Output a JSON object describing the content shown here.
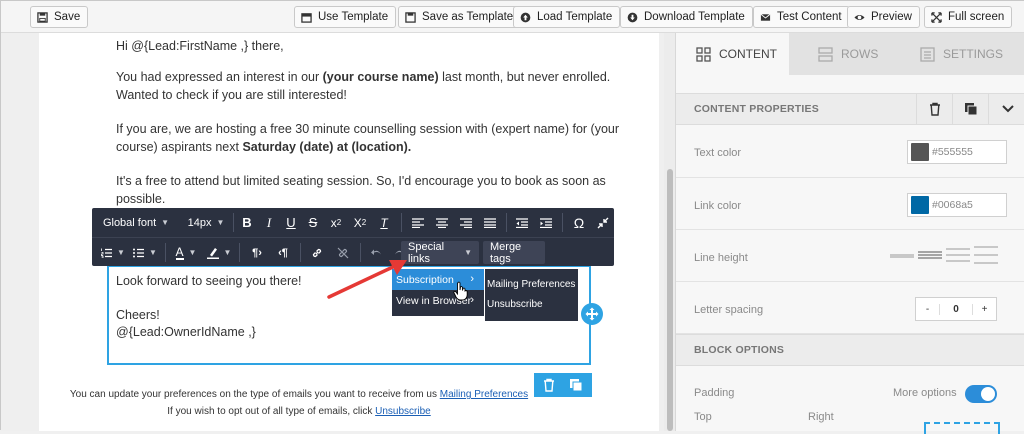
{
  "toolbar": {
    "save": "Save",
    "use_template": "Use Template",
    "save_as_template": "Save as Template",
    "load_template": "Load Template",
    "download_template": "Download Template",
    "test_content": "Test Content",
    "preview": "Preview",
    "full_screen": "Full screen"
  },
  "email": {
    "greeting": "Hi @{Lead:FirstName ,} there,",
    "p1a": "You had expressed an interest in our ",
    "p1b": "(your course name)",
    "p1c": " last month, but never enrolled.",
    "p1d": "Wanted to check if you are still interested!",
    "p2a": "If you are, we are hosting a free 30 minute counselling session with (expert name) for (your",
    "p2b": "course) aspirants next ",
    "p2c": "Saturday (date) at (location).",
    "p3a": "It's a free to attend but limited seating session. So, I'd encourage you to book as soon as",
    "p3b": "possible.",
    "p4": "Look forward to seeing you there!",
    "p5": "Cheers!",
    "p6": "@{Lead:OwnerIdName ,}",
    "footer1a": "You can update your preferences on the type of emails you want to receive from us ",
    "footer1b": "Mailing Preferences",
    "footer2a": "If you wish to opt out of all type of emails, click ",
    "footer2b": "Unsubscribe"
  },
  "rte": {
    "font": "Global font",
    "size": "14px",
    "special_links": "Special links",
    "merge_tags": "Merge tags",
    "omega": "Ω"
  },
  "menu": {
    "subscription": "Subscription",
    "view_in_browser": "View in Browser",
    "mailing_preferences": "Mailing Preferences",
    "unsubscribe": "Unsubscribe"
  },
  "panel": {
    "tab_content": "CONTENT",
    "tab_rows": "ROWS",
    "tab_settings": "SETTINGS",
    "content_properties": "CONTENT PROPERTIES",
    "text_color_label": "Text color",
    "text_color_value": "#555555",
    "link_color_label": "Link color",
    "link_color_value": "#0068a5",
    "line_height_label": "Line height",
    "letter_spacing_label": "Letter spacing",
    "letter_spacing_minus": "-",
    "letter_spacing_value": "0",
    "letter_spacing_plus": "+",
    "block_options": "BLOCK OPTIONS",
    "padding_label": "Padding",
    "more_options": "More options",
    "top_label": "Top",
    "right_label": "Right"
  },
  "colors": {
    "accent": "#2ea3e3",
    "toolbar_dark": "#2b3140",
    "text_color_swatch": "#555555",
    "link_color_swatch": "#0068a5",
    "arrow": "#e53935"
  }
}
